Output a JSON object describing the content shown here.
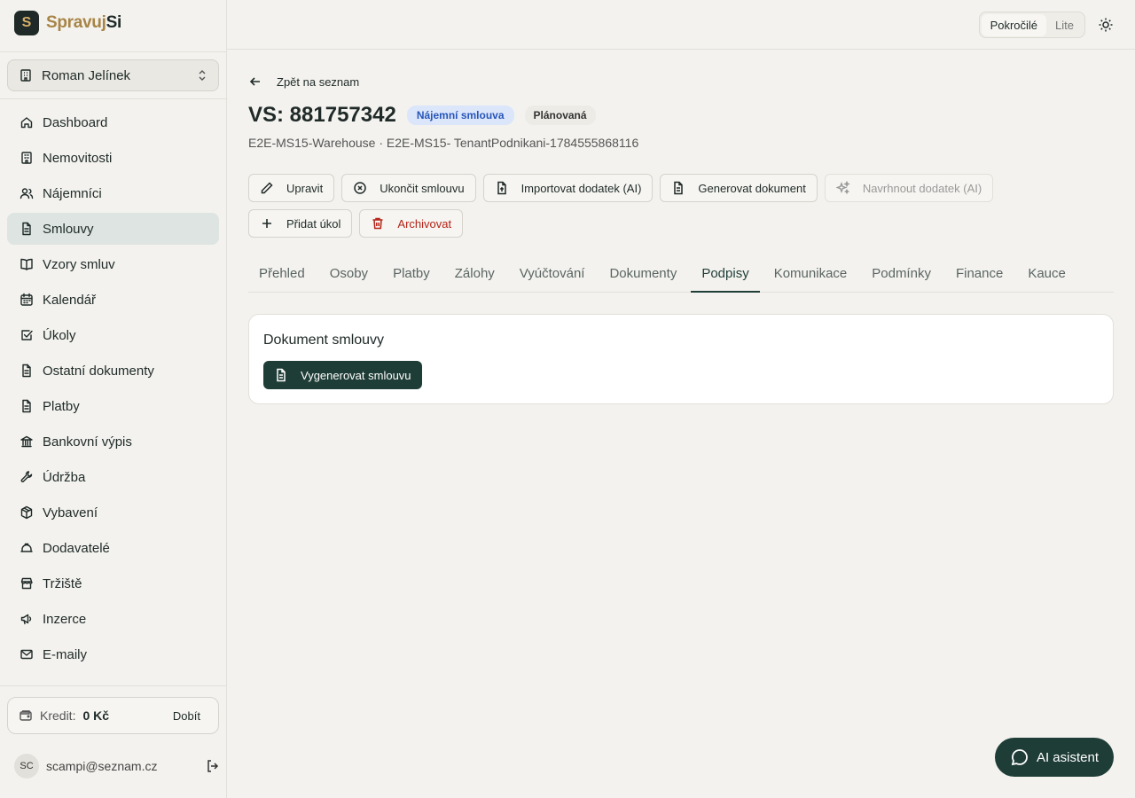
{
  "app": {
    "logo_part1": "Spravuj",
    "logo_part2": "Si",
    "logo_mark": "S"
  },
  "org_selector": {
    "value": "Roman Jelínek"
  },
  "sidebar": {
    "items": [
      {
        "label": "Dashboard",
        "icon": "home-icon"
      },
      {
        "label": "Nemovitosti",
        "icon": "building-icon"
      },
      {
        "label": "Nájemníci",
        "icon": "users-icon"
      },
      {
        "label": "Smlouvy",
        "icon": "document-icon",
        "active": true
      },
      {
        "label": "Vzory smluv",
        "icon": "book-icon"
      },
      {
        "label": "Kalendář",
        "icon": "calendar-icon"
      },
      {
        "label": "Úkoly",
        "icon": "checkbox-icon"
      },
      {
        "label": "Ostatní dokumenty",
        "icon": "folder-icon"
      },
      {
        "label": "Platby",
        "icon": "document-icon"
      },
      {
        "label": "Bankovní výpis",
        "icon": "bank-icon"
      },
      {
        "label": "Údržba",
        "icon": "wrench-icon"
      },
      {
        "label": "Vybavení",
        "icon": "package-icon"
      },
      {
        "label": "Dodavatelé",
        "icon": "hardhat-icon"
      },
      {
        "label": "Tržiště",
        "icon": "store-icon"
      },
      {
        "label": "Inzerce",
        "icon": "megaphone-icon"
      },
      {
        "label": "E-maily",
        "icon": "mail-icon"
      }
    ]
  },
  "credit": {
    "label": "Kredit:",
    "value": "0 Kč",
    "topup": "Dobít"
  },
  "user": {
    "initials": "SC",
    "email": "scampi@seznam.cz"
  },
  "topbar": {
    "mode_advanced": "Pokročilé",
    "mode_lite": "Lite"
  },
  "main": {
    "back_label": "Zpět na seznam",
    "title": "VS: 881757342",
    "badge_type": "Nájemní smlouva",
    "badge_status": "Plánovaná",
    "subtitle": "E2E-MS15-Warehouse · E2E-MS15- TenantPodnikani-1784555868116",
    "actions": {
      "edit": "Upravit",
      "terminate": "Ukončit smlouvu",
      "import": "Importovat dodatek (AI)",
      "generate": "Generovat dokument",
      "propose": "Navrhnout dodatek (AI)",
      "add_task": "Přidat úkol",
      "archive": "Archivovat"
    },
    "tabs": [
      "Přehled",
      "Osoby",
      "Platby",
      "Zálohy",
      "Vyúčtování",
      "Dokumenty",
      "Podpisy",
      "Komunikace",
      "Podmínky",
      "Finance",
      "Kauce"
    ],
    "active_tab": "Podpisy",
    "card": {
      "title": "Dokument smlouvy",
      "button": "Vygenerovat smlouvu"
    }
  },
  "ai_assistant": {
    "label": "AI asistent"
  },
  "colors": {
    "accent": "#1f3d37",
    "badge_blue": "#2856b8",
    "danger": "#b42318",
    "brand_gold": "#a88445"
  }
}
